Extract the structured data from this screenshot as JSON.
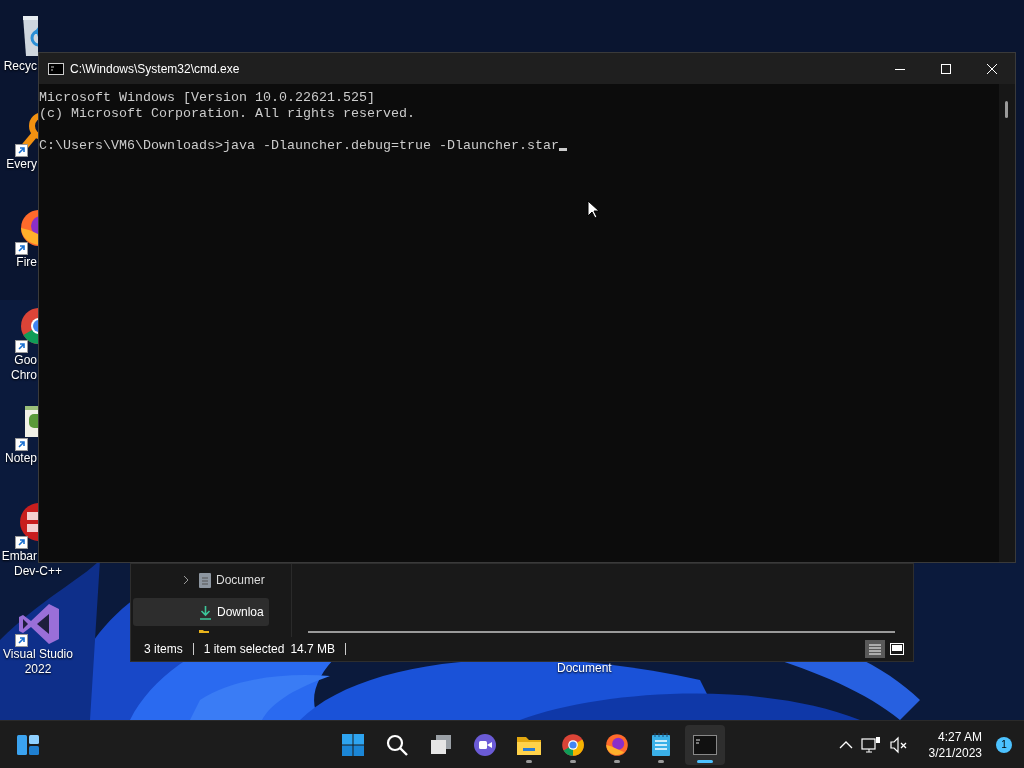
{
  "desktop_icons": [
    {
      "lines": [
        "Recyc"
      ],
      "shortcut": false
    },
    {
      "lines": [
        "Every"
      ],
      "shortcut": true
    },
    {
      "lines": [
        "Fire"
      ],
      "shortcut": true
    },
    {
      "lines": [
        "Goo",
        "Chro"
      ],
      "shortcut": true
    },
    {
      "lines": [
        "Notep"
      ],
      "shortcut": true
    },
    {
      "lines": [
        "Embar",
        "Dev-C++"
      ],
      "shortcut": true
    },
    {
      "lines": [
        "Visual Studio",
        "2022"
      ],
      "shortcut": true
    }
  ],
  "desktop_label": "Document",
  "explorer": {
    "nav_items": [
      {
        "label": "Documer",
        "selected": false,
        "has_children": true
      },
      {
        "label": "Downloa",
        "selected": true,
        "has_children": false
      }
    ],
    "status": [
      "3 items",
      "1 item selected",
      "14.7 MB"
    ],
    "views": [
      {
        "selected": true
      },
      {
        "selected": false
      }
    ]
  },
  "cmd": {
    "title": "C:\\Windows\\System32\\cmd.exe",
    "blocks": [
      [
        "Microsoft Windows [Version 10.0.22621.525]",
        "(c) Microsoft Corporation. All rights reserved."
      ],
      [
        "C:\\Users\\VM6\\Downloads>java -Dlauncher.debug=true -Dlauncher.star"
      ]
    ],
    "cursor_visible": true
  },
  "taskbar": {
    "apps": [
      {
        "running": false,
        "active": false
      },
      {
        "running": false,
        "active": false
      },
      {
        "running": false,
        "active": false
      },
      {
        "running": false,
        "active": false
      },
      {
        "running": true,
        "active": false
      },
      {
        "running": true,
        "active": false
      },
      {
        "running": true,
        "active": false
      },
      {
        "running": true,
        "active": false
      },
      {
        "running": true,
        "active": true
      }
    ],
    "time": "4:27 AM",
    "date": "3/21/2023",
    "notifications": "1"
  }
}
